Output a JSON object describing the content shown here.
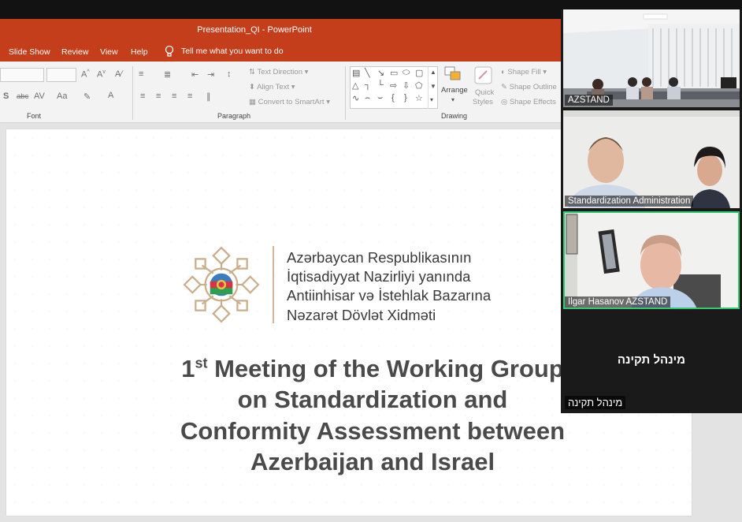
{
  "window": {
    "title": "Presentation_QI  -  PowerPoint"
  },
  "ribbon_tabs": [
    "Slide Show",
    "Review",
    "View",
    "Help"
  ],
  "tell_me": "Tell me what you want to do",
  "ribbon": {
    "font_group": "Font",
    "paragraph_group": "Paragraph",
    "drawing_group": "Drawing",
    "text_direction": "Text Direction",
    "align_text": "Align Text",
    "convert_smartart": "Convert to SmartArt",
    "arrange": "Arrange",
    "quick_styles_line1": "Quick",
    "quick_styles_line2": "Styles",
    "shape_fill": "Shape Fill",
    "shape_outline": "Shape Outline",
    "shape_effects": "Shape Effects",
    "font_btn_s": "S",
    "font_btn_abc": "abc",
    "font_btn_av": "AV",
    "font_btn_aa": "Aa",
    "font_btn_a": "A"
  },
  "slide": {
    "org_lines": [
      "Azərbaycan Respublikasının",
      "İqtisadiyyat Nazirliyi yanında",
      "Antiinhisar və İstehlak Bazarına",
      "Nəzarət Dövlət Xidməti"
    ],
    "meeting_ordinal": "1",
    "meeting_sup": "st",
    "meeting_line1_rest": " Meeting of the Working Group",
    "meeting_line2": "on Standardization and",
    "meeting_line3": "Conformity Assessment between",
    "meeting_line4": "Azerbaijan and Israel"
  },
  "zoom": {
    "participants": [
      {
        "name": "AZSTAND"
      },
      {
        "name": "Standardization Administration"
      },
      {
        "name": "Ilgar Hasanov AZSTAND"
      }
    ],
    "no_video_big": "מינהל תקינה",
    "no_video_small": "מינהל תקינה"
  },
  "colors": {
    "ppt_accent": "#c43e1c",
    "active_speaker": "#2ecc71",
    "emblem_gold": "#c9ae8c"
  }
}
